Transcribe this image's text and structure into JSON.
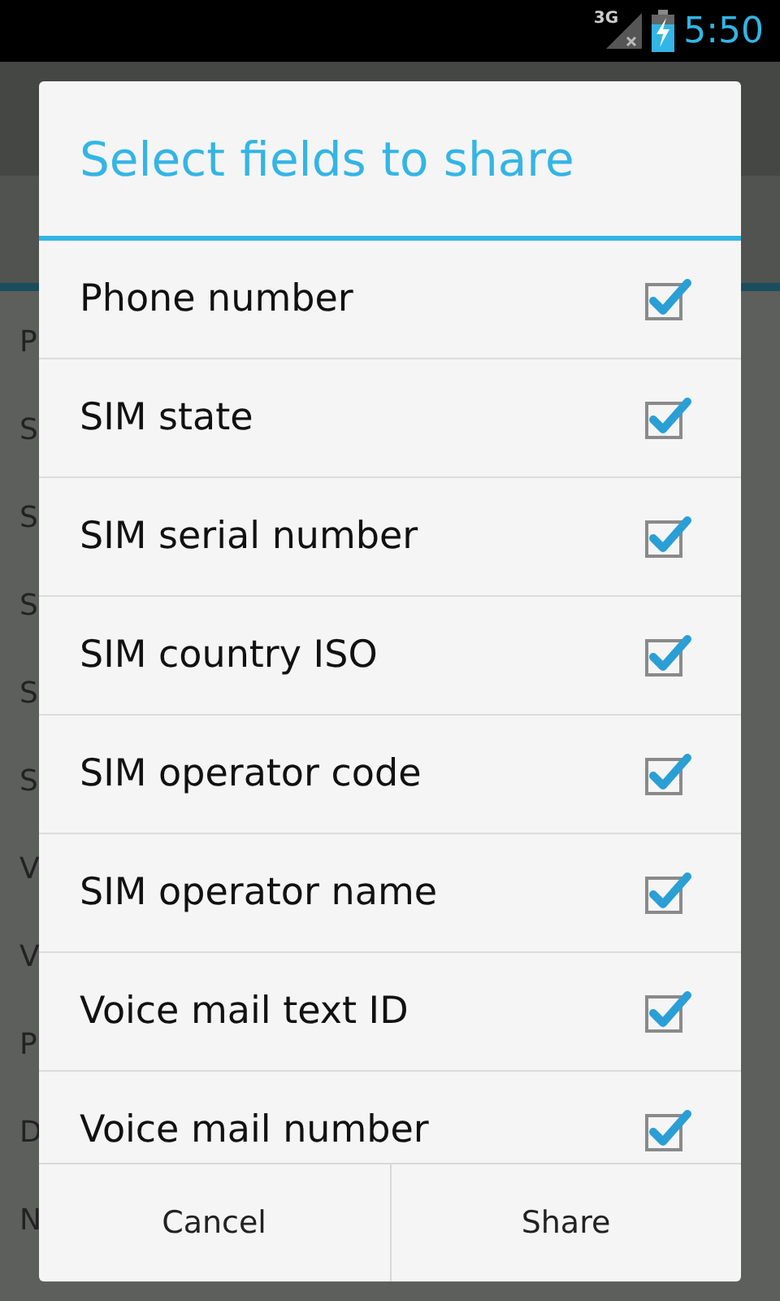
{
  "status_bar": {
    "network": "3G",
    "time": "5:50"
  },
  "background_list": [
    {
      "text": "P"
    },
    {
      "text": "S"
    },
    {
      "text": "S"
    },
    {
      "text": "S"
    },
    {
      "text": "S"
    },
    {
      "text": "S"
    },
    {
      "text": "V"
    },
    {
      "text": "V"
    },
    {
      "text": "P"
    },
    {
      "text": "D"
    },
    {
      "text": "N"
    }
  ],
  "dialog": {
    "title": "Select fields to share",
    "fields": [
      {
        "label": "Phone number",
        "checked": true
      },
      {
        "label": "SIM state",
        "checked": true
      },
      {
        "label": "SIM serial number",
        "checked": true
      },
      {
        "label": "SIM country ISO",
        "checked": true
      },
      {
        "label": "SIM operator code",
        "checked": true
      },
      {
        "label": "SIM operator name",
        "checked": true
      },
      {
        "label": "Voice mail text ID",
        "checked": true
      },
      {
        "label": "Voice mail number",
        "checked": true
      }
    ],
    "buttons": [
      "Cancel",
      "Share"
    ]
  }
}
